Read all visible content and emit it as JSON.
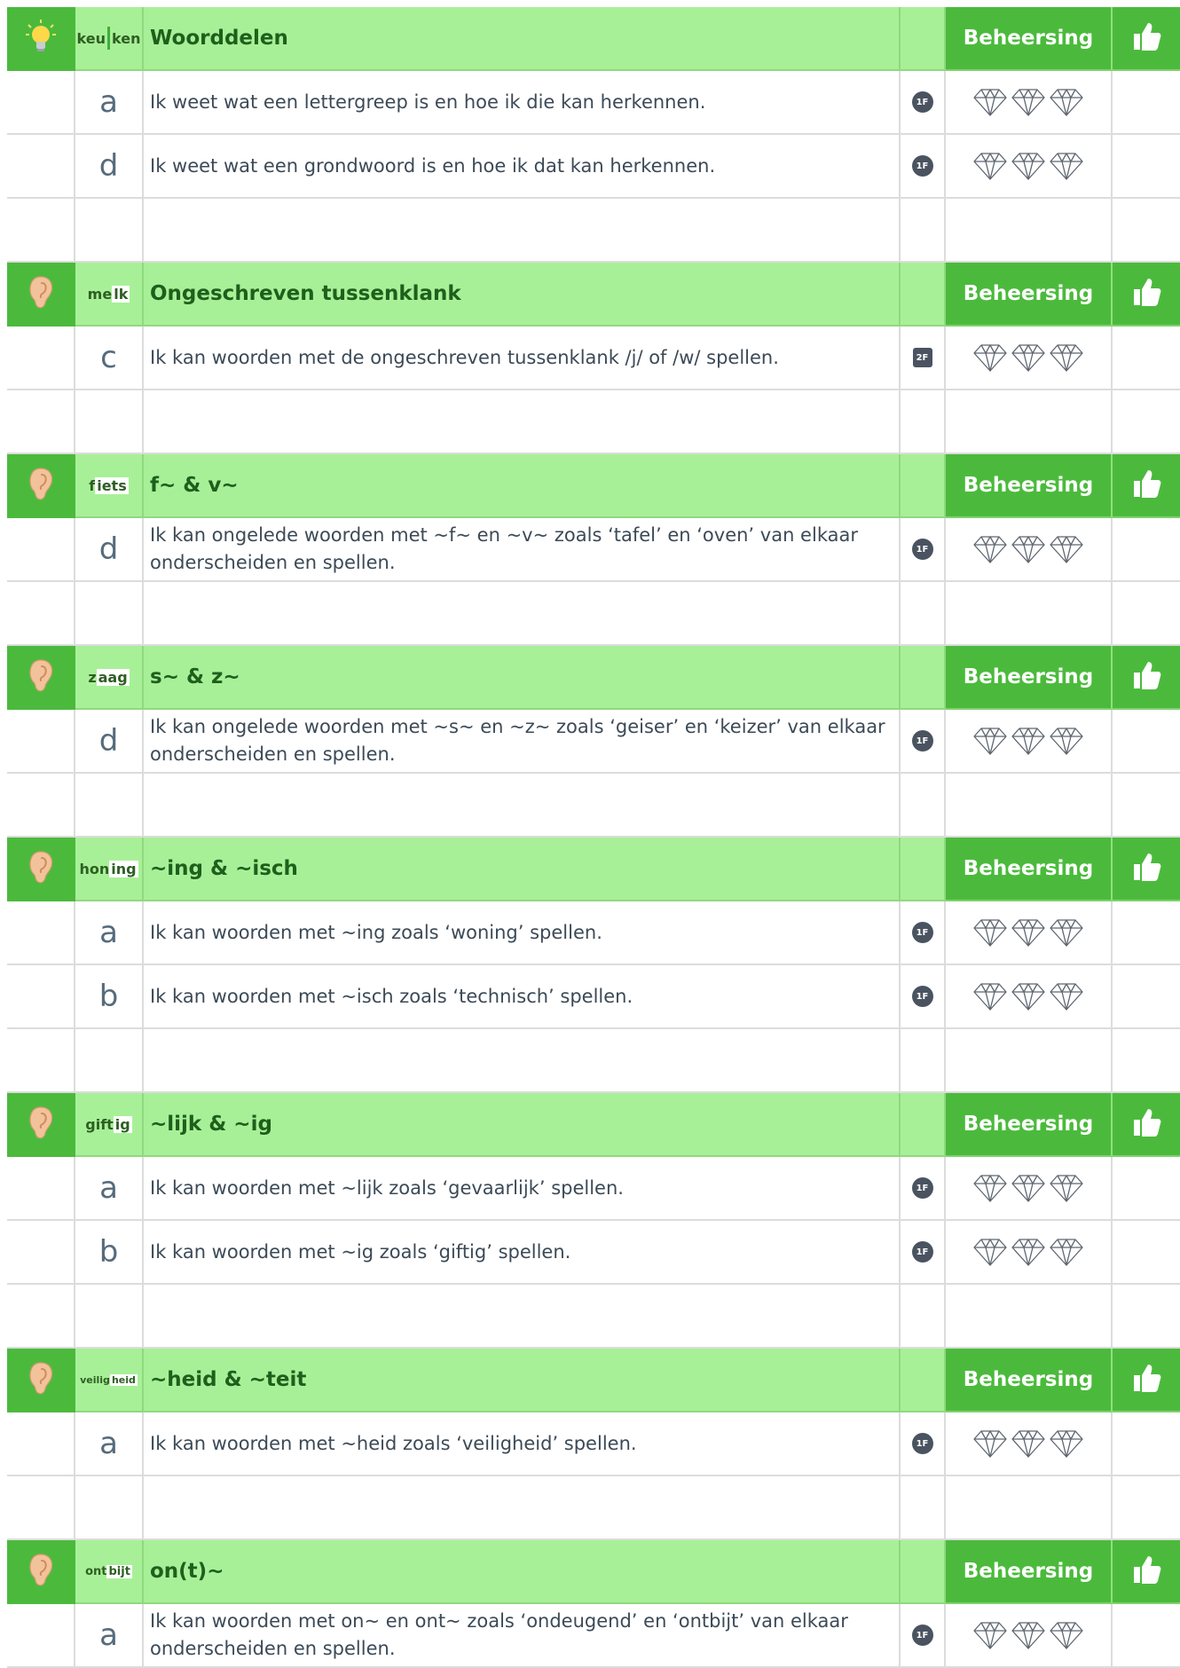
{
  "colors": {
    "header_dark": "#4bba3c",
    "header_light": "#a8f098",
    "title_text": "#1f5f1c",
    "badge": "#4a5360"
  },
  "sections": [
    {
      "icon": "lightbulb-icon",
      "example": {
        "a": "keu",
        "b": "ken"
      },
      "title": "Woorddelen",
      "mastery_label": "Beheersing",
      "goals": [
        {
          "letter": "a",
          "text": "Ik weet wat een lettergreep is en hoe ik die kan herkennen.",
          "level": "1F"
        },
        {
          "letter": "d",
          "text": "Ik weet wat een grondwoord is en hoe ik dat kan herkennen.",
          "level": "1F"
        }
      ]
    },
    {
      "icon": "ear-icon",
      "example": {
        "a": "me",
        "b": "lk"
      },
      "title": "Ongeschreven tussenklank",
      "mastery_label": "Beheersing",
      "goals": [
        {
          "letter": "c",
          "text": "Ik kan woorden met de ongeschreven tussenklank /j/ of /w/ spellen.",
          "level": "2F"
        }
      ]
    },
    {
      "icon": "ear-icon",
      "example": {
        "a": "f",
        "b": "iets"
      },
      "title": "f~ & v~",
      "mastery_label": "Beheersing",
      "goals": [
        {
          "letter": "d",
          "text": "Ik kan ongelede woorden met ~f~ en ~v~ zoals ‘tafel’ en ‘oven’ van elkaar onderscheiden en spellen.",
          "level": "1F"
        }
      ]
    },
    {
      "icon": "ear-icon",
      "example": {
        "a": "z",
        "b": "aag"
      },
      "title": "s~ & z~",
      "mastery_label": "Beheersing",
      "goals": [
        {
          "letter": "d",
          "text": "Ik kan ongelede woorden met ~s~ en ~z~ zoals ‘geiser’ en ‘keizer’ van elkaar onderscheiden en spellen.",
          "level": "1F"
        }
      ]
    },
    {
      "icon": "ear-icon",
      "example": {
        "a": "hon",
        "b": "ing"
      },
      "title": "~ing & ~isch",
      "mastery_label": "Beheersing",
      "goals": [
        {
          "letter": "a",
          "text": "Ik kan woorden met ~ing zoals ‘woning’ spellen.",
          "level": "1F"
        },
        {
          "letter": "b",
          "text": "Ik kan woorden met ~isch zoals ‘technisch’ spellen.",
          "level": "1F"
        }
      ]
    },
    {
      "icon": "ear-icon",
      "example": {
        "a": "gift",
        "b": "ig"
      },
      "title": "~lijk & ~ig",
      "mastery_label": "Beheersing",
      "goals": [
        {
          "letter": "a",
          "text": "Ik kan woorden met ~lijk zoals ‘gevaarlijk’ spellen.",
          "level": "1F"
        },
        {
          "letter": "b",
          "text": "Ik kan woorden met ~ig zoals ‘giftig’ spellen.",
          "level": "1F"
        }
      ]
    },
    {
      "icon": "ear-icon",
      "example": {
        "a": "veilig",
        "b": "heid"
      },
      "title": "~heid & ~teit",
      "mastery_label": "Beheersing",
      "goals": [
        {
          "letter": "a",
          "text": "Ik kan woorden met ~heid zoals ‘veiligheid’ spellen.",
          "level": "1F"
        }
      ]
    },
    {
      "icon": "ear-icon",
      "example": {
        "a": "ont",
        "b": "bijt"
      },
      "title": "on(t)~",
      "mastery_label": "Beheersing",
      "goals": [
        {
          "letter": "a",
          "text": "Ik kan woorden met on~ en ont~ zoals ‘ondeugend’ en ‘ontbijt’ van elkaar onderscheiden en spellen.",
          "level": "1F"
        }
      ]
    }
  ]
}
